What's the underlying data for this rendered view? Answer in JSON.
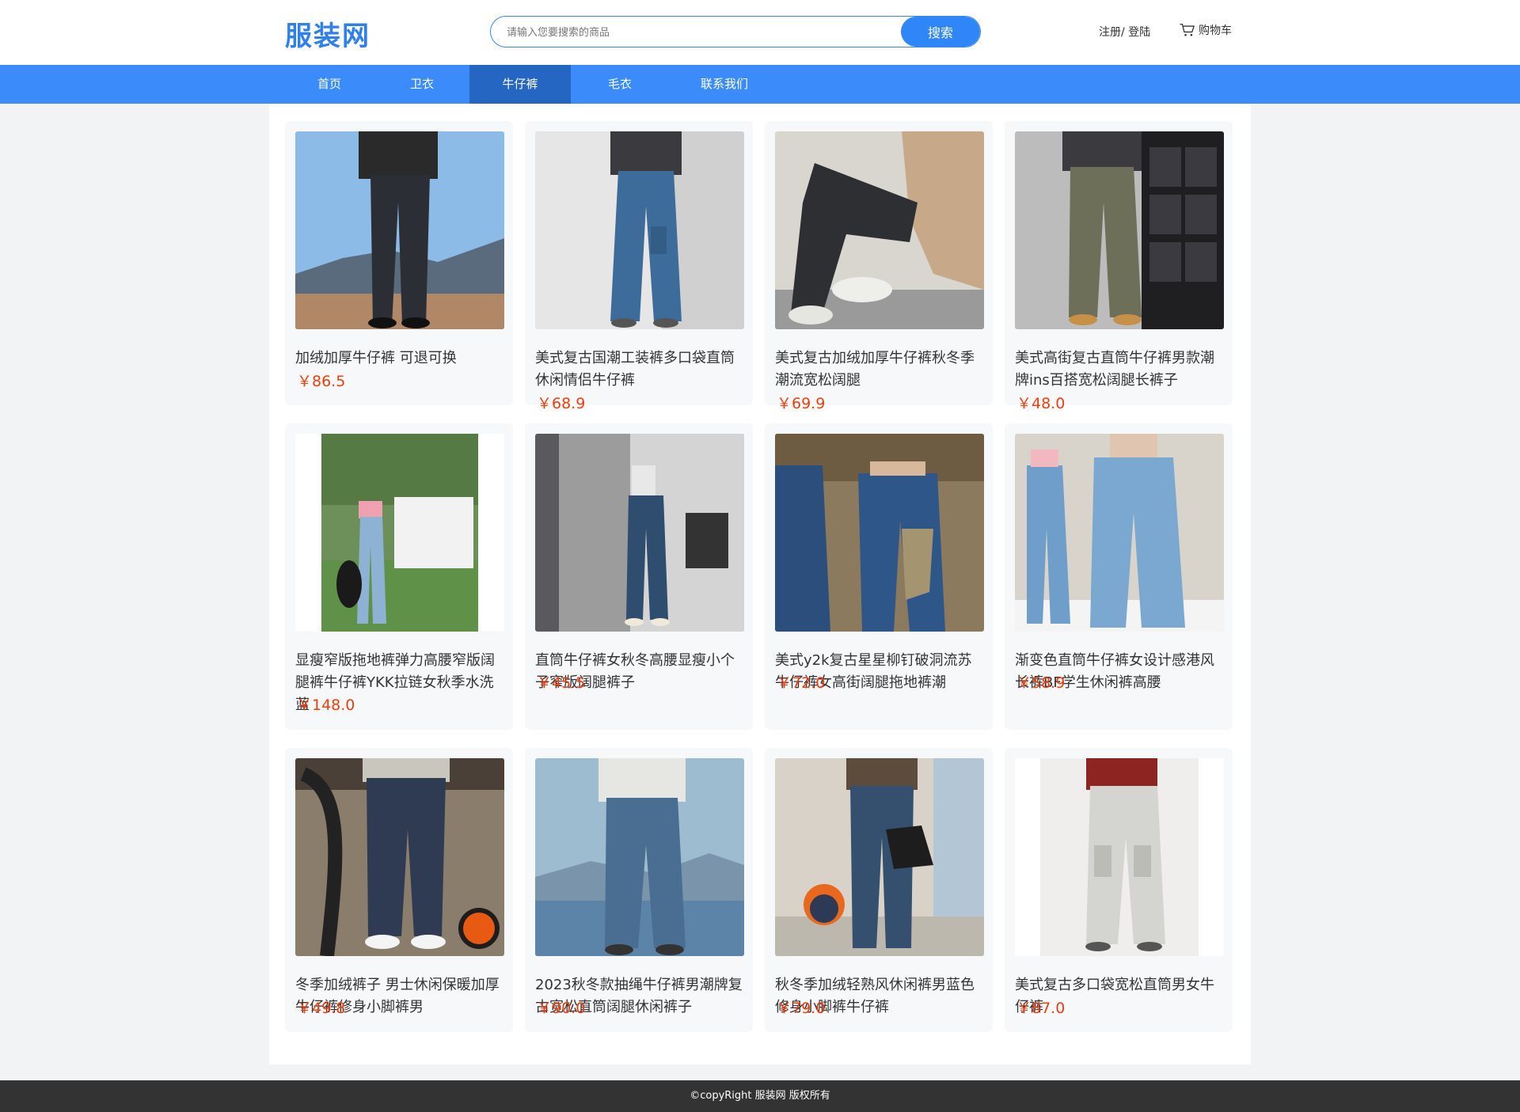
{
  "header": {
    "logo": "服装网",
    "search": {
      "placeholder": "请输入您要搜索的商品",
      "value": "",
      "button_label": "搜索"
    },
    "register_label": "注册/",
    "login_label": "登陆",
    "cart_label": "购物车",
    "cart_icon": "cart-icon"
  },
  "nav": {
    "items": [
      {
        "label": "首页",
        "active": false
      },
      {
        "label": "卫衣",
        "active": false
      },
      {
        "label": "牛仔裤",
        "active": true
      },
      {
        "label": "毛衣",
        "active": false
      },
      {
        "label": "联系我们",
        "active": false
      }
    ]
  },
  "products": [
    {
      "title": "加绒加厚牛仔裤 可退可换",
      "price": "￥86.5"
    },
    {
      "title": "美式复古国潮工装裤多口袋直筒休闲情侣牛仔裤",
      "price": "￥68.9"
    },
    {
      "title": "美式复古加绒加厚牛仔裤秋冬季潮流宽松阔腿",
      "price": "￥69.9"
    },
    {
      "title": "美式高街复古直筒牛仔裤男款潮牌ins百搭宽松阔腿长裤子",
      "price": "￥48.0"
    },
    {
      "title": "显瘦窄版拖地裤弹力高腰窄版阔腿裤牛仔裤YKK拉链女秋季水洗蓝",
      "price": "￥148.0"
    },
    {
      "title": "直筒牛仔裤女秋冬高腰显瘦小个子窄版阔腿裤子",
      "price": "￥45.5"
    },
    {
      "title": "美式y2k复古星星柳钉破洞流苏牛仔裤女高街阔腿拖地裤潮",
      "price": "￥72.0"
    },
    {
      "title": "渐变色直筒牛仔裤女设计感港风长裤BF学生休闲裤高腰",
      "price": "￥58.9"
    },
    {
      "title": "冬季加绒裤子 男士休闲保暖加厚牛仔裤修身小脚裤男",
      "price": "￥49.8"
    },
    {
      "title": "2023秋冬款抽绳牛仔裤男潮牌复古宽松直筒阔腿休闲裤子",
      "price": "￥90.0"
    },
    {
      "title": "秋冬季加绒轻熟风休闲裤男蓝色修身小脚裤牛仔裤",
      "price": "￥79.0"
    },
    {
      "title": "美式复古多口袋宽松直筒男女牛仔裤",
      "price": "￥87.0"
    }
  ],
  "footer": {
    "text": "©copyRight 服装网 版权所有"
  },
  "colors": {
    "brand": "#2f80ed",
    "nav": "#3b8cfa",
    "nav_active": "#2566c2",
    "price": "#ef3e0e"
  }
}
